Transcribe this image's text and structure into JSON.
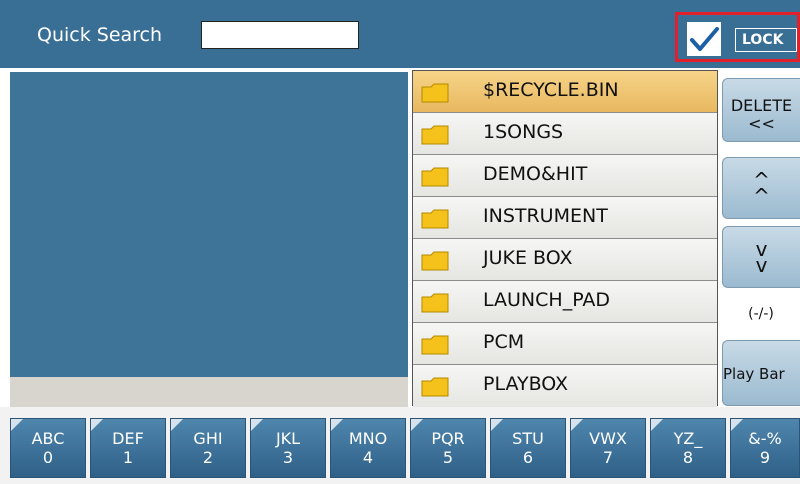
{
  "search": {
    "label": "Quick Search",
    "value": ""
  },
  "lock": {
    "label": "LOCK",
    "checked": true,
    "highlight_color": "#e0202a"
  },
  "files": [
    {
      "name": "$RECYCLE.BIN",
      "selected": true
    },
    {
      "name": "1SONGS"
    },
    {
      "name": "DEMO&HIT"
    },
    {
      "name": "INSTRUMENT"
    },
    {
      "name": "JUKE BOX"
    },
    {
      "name": "LAUNCH_PAD"
    },
    {
      "name": "PCM"
    },
    {
      "name": "PLAYBOX"
    }
  ],
  "buttons": {
    "delete_line1": "DELETE",
    "delete_line2": "<<",
    "up": "^",
    "down": "v",
    "page_indicator": "(-/-)",
    "play_bar": "Play Bar"
  },
  "keys": [
    {
      "letters": "ABC",
      "digit": "0"
    },
    {
      "letters": "DEF",
      "digit": "1"
    },
    {
      "letters": "GHI",
      "digit": "2"
    },
    {
      "letters": "JKL",
      "digit": "3"
    },
    {
      "letters": "MNO",
      "digit": "4"
    },
    {
      "letters": "PQR",
      "digit": "5"
    },
    {
      "letters": "STU",
      "digit": "6"
    },
    {
      "letters": "VWX",
      "digit": "7"
    },
    {
      "letters": "YZ_",
      "digit": "8"
    },
    {
      "letters": "&-%",
      "digit": "9"
    }
  ],
  "colors": {
    "bar": "#3a6f95",
    "selected_row": "#f0c878",
    "folder": "#f4c21a"
  }
}
